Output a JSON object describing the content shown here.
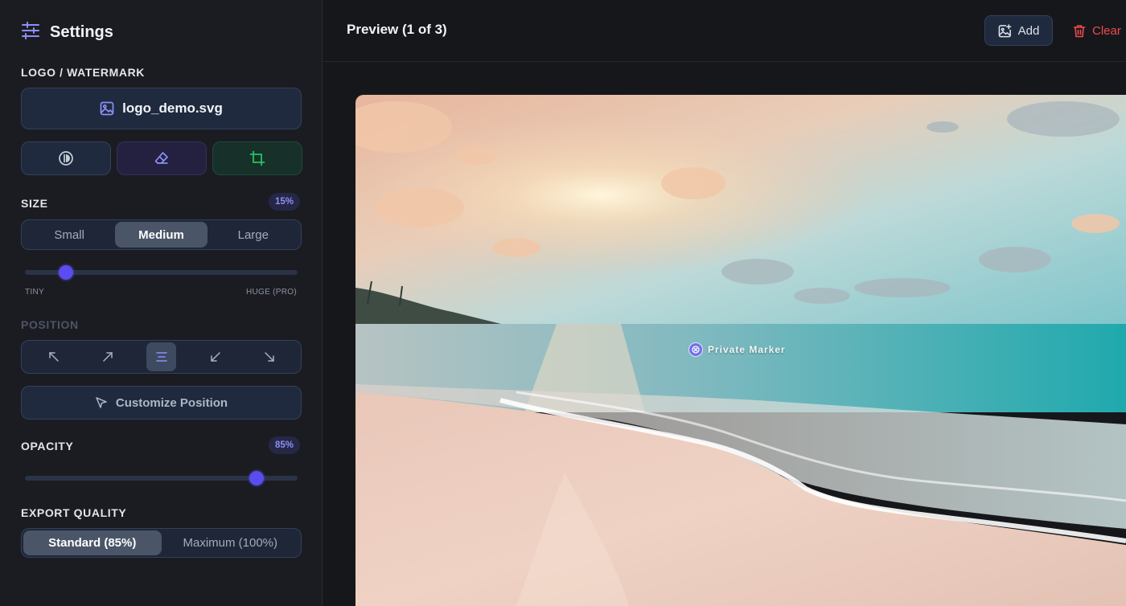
{
  "sidebar": {
    "title": "Settings",
    "logo_section": {
      "label": "LOGO / WATERMARK",
      "file_name": "logo_demo.svg"
    },
    "size_section": {
      "label": "SIZE",
      "badge": "15%",
      "options": [
        "Small",
        "Medium",
        "Large"
      ],
      "selected": "Medium",
      "slider_value_percent": 15,
      "min_caption": "TINY",
      "max_caption": "HUGE (PRO)"
    },
    "position_section": {
      "label": "POSITION",
      "selected": "center",
      "customize_label": "Customize Position"
    },
    "opacity_section": {
      "label": "OPACITY",
      "badge": "85%",
      "slider_value_percent": 85
    },
    "export_section": {
      "label": "EXPORT QUALITY",
      "options": [
        "Standard (85%)",
        "Maximum (100%)"
      ],
      "selected": "Standard (85%)"
    }
  },
  "main": {
    "preview_title": "Preview (1 of 3)",
    "add_label": "Add",
    "clear_label": "Clear",
    "watermark_text": "Private Marker"
  },
  "colors": {
    "accent": "#5b4cf0",
    "danger": "#ef4b4b",
    "success": "#22c55e",
    "panel": "#1f2a3e"
  },
  "icons": {
    "settings": "sliders-icon",
    "logo_file": "image-icon",
    "add": "image-plus-icon",
    "clear": "trash-icon",
    "customize": "cursor-arrow-icon"
  }
}
